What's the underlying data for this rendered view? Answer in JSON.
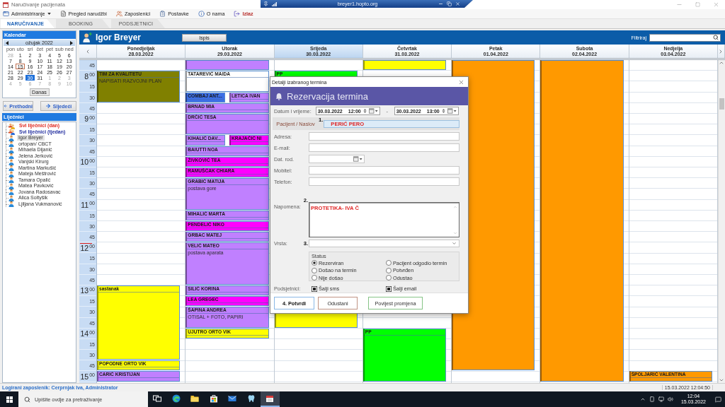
{
  "window": {
    "title": "Naručivanje pacijenata",
    "remote_host": "breyer1.hopto.org"
  },
  "menu": [
    {
      "label": "Administriranje",
      "kind": "dropdown"
    },
    {
      "label": "Pregled narudžbi",
      "kind": "item"
    },
    {
      "label": "Zaposlenici",
      "kind": "item"
    },
    {
      "label": "Postavke",
      "kind": "item"
    },
    {
      "label": "O nama",
      "kind": "item"
    },
    {
      "label": "Izlaz",
      "kind": "exit"
    }
  ],
  "tabs": [
    {
      "label": "NARUČIVANJE",
      "selected": true
    },
    {
      "label": "BOOKING",
      "selected": false
    },
    {
      "label": "PODSJETNICI",
      "selected": false
    }
  ],
  "calendar": {
    "title": "Kalendar",
    "month": "ožujak 2022",
    "weekdays": [
      "pon",
      "uto",
      "sri",
      "čet",
      "pet",
      "sub",
      "ned"
    ],
    "weeks": [
      [
        {
          "day": "28",
          "other_month": true,
          "today": false,
          "selected": false
        },
        {
          "day": "1",
          "other_month": false,
          "today": false,
          "selected": false
        },
        {
          "day": "2",
          "other_month": false,
          "today": false,
          "selected": false
        },
        {
          "day": "3",
          "other_month": false,
          "today": false,
          "selected": false
        },
        {
          "day": "4",
          "other_month": false,
          "today": false,
          "selected": false
        },
        {
          "day": "5",
          "other_month": false,
          "today": false,
          "selected": false
        },
        {
          "day": "6",
          "other_month": false,
          "today": false,
          "selected": false
        }
      ],
      [
        {
          "day": "7",
          "other_month": false,
          "today": false,
          "selected": false
        },
        {
          "day": "8",
          "other_month": false,
          "today": false,
          "selected": false
        },
        {
          "day": "9",
          "other_month": false,
          "today": false,
          "selected": false
        },
        {
          "day": "10",
          "other_month": false,
          "today": false,
          "selected": false
        },
        {
          "day": "11",
          "other_month": false,
          "today": false,
          "selected": false
        },
        {
          "day": "12",
          "other_month": false,
          "today": false,
          "selected": false
        },
        {
          "day": "13",
          "other_month": false,
          "today": false,
          "selected": false
        }
      ],
      [
        {
          "day": "14",
          "other_month": false,
          "today": false,
          "selected": false
        },
        {
          "day": "15",
          "other_month": false,
          "today": true,
          "selected": false
        },
        {
          "day": "16",
          "other_month": false,
          "today": false,
          "selected": false
        },
        {
          "day": "17",
          "other_month": false,
          "today": false,
          "selected": false
        },
        {
          "day": "18",
          "other_month": false,
          "today": false,
          "selected": false
        },
        {
          "day": "19",
          "other_month": false,
          "today": false,
          "selected": false
        },
        {
          "day": "20",
          "other_month": false,
          "today": false,
          "selected": false
        }
      ],
      [
        {
          "day": "21",
          "other_month": false,
          "today": false,
          "selected": false
        },
        {
          "day": "22",
          "other_month": false,
          "today": false,
          "selected": false
        },
        {
          "day": "23",
          "other_month": false,
          "today": false,
          "selected": false
        },
        {
          "day": "24",
          "other_month": false,
          "today": false,
          "selected": false
        },
        {
          "day": "25",
          "other_month": false,
          "today": false,
          "selected": false
        },
        {
          "day": "26",
          "other_month": false,
          "today": false,
          "selected": false
        },
        {
          "day": "27",
          "other_month": false,
          "today": false,
          "selected": false
        }
      ],
      [
        {
          "day": "28",
          "other_month": false,
          "today": false,
          "selected": false
        },
        {
          "day": "29",
          "other_month": false,
          "today": false,
          "selected": false
        },
        {
          "day": "30",
          "other_month": false,
          "today": false,
          "selected": true
        },
        {
          "day": "31",
          "other_month": false,
          "today": false,
          "selected": false
        },
        {
          "day": "1",
          "other_month": true,
          "today": false,
          "selected": false
        },
        {
          "day": "2",
          "other_month": true,
          "today": false,
          "selected": false
        },
        {
          "day": "3",
          "other_month": true,
          "today": false,
          "selected": false
        }
      ],
      [
        {
          "day": "4",
          "other_month": true,
          "today": false,
          "selected": false
        },
        {
          "day": "5",
          "other_month": true,
          "today": false,
          "selected": false
        },
        {
          "day": "6",
          "other_month": true,
          "today": false,
          "selected": false
        },
        {
          "day": "7",
          "other_month": true,
          "today": false,
          "selected": false
        },
        {
          "day": "8",
          "other_month": true,
          "today": false,
          "selected": false
        },
        {
          "day": "9",
          "other_month": true,
          "today": false,
          "selected": false
        },
        {
          "day": "10",
          "other_month": true,
          "today": false,
          "selected": false
        }
      ]
    ],
    "today_button": "Danas"
  },
  "navigation": {
    "previous": "Prethodni",
    "next": "Sljedeći"
  },
  "doctors": {
    "title": "Liječnici",
    "items": [
      {
        "label": "Svi liječnici (dan)",
        "kind": "all_day",
        "selected": false
      },
      {
        "label": "Svi liječnici (tjedan)",
        "kind": "all_week",
        "selected": false
      },
      {
        "label": "Igor Breyer",
        "kind": "doctor",
        "selected": true
      },
      {
        "label": "ortopan/ CBCT",
        "kind": "doctor",
        "selected": false
      },
      {
        "label": "Mihaela Dijanić",
        "kind": "doctor",
        "selected": false
      },
      {
        "label": "Jelena Jerković",
        "kind": "doctor",
        "selected": false
      },
      {
        "label": "Vanjski Kirurg",
        "kind": "doctor",
        "selected": false
      },
      {
        "label": "Martina Markušić",
        "kind": "doctor",
        "selected": false
      },
      {
        "label": "Mateja Meštrović",
        "kind": "doctor",
        "selected": false
      },
      {
        "label": "Tamara Opalić",
        "kind": "doctor",
        "selected": false
      },
      {
        "label": "Matea Pavković",
        "kind": "doctor",
        "selected": false
      },
      {
        "label": "Jovana Radosavac",
        "kind": "doctor",
        "selected": false
      },
      {
        "label": "Alica Soltyšik",
        "kind": "doctor",
        "selected": false
      },
      {
        "label": "Ljiljana Vukmanović",
        "kind": "doctor",
        "selected": false
      }
    ]
  },
  "schedule": {
    "doctor": "Igor Breyer",
    "print_button": "Ispis",
    "filter_label": "Filtriraj",
    "time_slots": [
      {
        "minute": "45",
        "now": false
      },
      {
        "hour": "8",
        "minute": "00",
        "now": false
      },
      {
        "minute": "15",
        "now": false
      },
      {
        "minute": "30",
        "now": false
      },
      {
        "minute": "45",
        "now": false
      },
      {
        "hour": "9",
        "minute": "00",
        "now": false
      },
      {
        "minute": "15",
        "now": false
      },
      {
        "minute": "30",
        "now": false
      },
      {
        "minute": "45",
        "now": false
      },
      {
        "hour": "10",
        "minute": "00",
        "now": false
      },
      {
        "minute": "15",
        "now": false
      },
      {
        "minute": "30",
        "now": false
      },
      {
        "minute": "45",
        "now": false
      },
      {
        "hour": "11",
        "minute": "00",
        "now": false
      },
      {
        "minute": "15",
        "now": false
      },
      {
        "minute": "30",
        "now": false
      },
      {
        "minute": "45",
        "now": false
      },
      {
        "hour": "12",
        "minute": "00",
        "now": true
      },
      {
        "minute": "15",
        "now": false
      },
      {
        "minute": "30",
        "now": false
      },
      {
        "minute": "45",
        "now": false
      },
      {
        "hour": "13",
        "minute": "00",
        "now": false
      },
      {
        "minute": "15",
        "now": false
      },
      {
        "minute": "30",
        "now": false
      },
      {
        "minute": "45",
        "now": false
      },
      {
        "hour": "14",
        "minute": "00",
        "now": false
      },
      {
        "minute": "15",
        "now": false
      },
      {
        "minute": "30",
        "now": false
      },
      {
        "minute": "45",
        "now": false
      },
      {
        "hour": "15",
        "minute": "00",
        "now": false
      }
    ],
    "days": [
      {
        "name": "Ponedjeljak",
        "date": "28.03.2022",
        "selected": false,
        "rows": [
          {
            "kind": "empty"
          },
          {
            "kind": "appointment",
            "title": "TIM ZA KVALITETU",
            "note": "NAPISATI RAZVOJNI PLAN",
            "color": "#808000"
          },
          {
            "kind": "continued"
          },
          {
            "kind": "continued"
          },
          {
            "kind": "empty"
          },
          {
            "kind": "empty"
          },
          {
            "kind": "empty"
          },
          {
            "kind": "empty"
          },
          {
            "kind": "empty"
          },
          {
            "kind": "empty"
          },
          {
            "kind": "empty"
          },
          {
            "kind": "empty"
          },
          {
            "kind": "empty"
          },
          {
            "kind": "empty"
          },
          {
            "kind": "empty"
          },
          {
            "kind": "empty"
          },
          {
            "kind": "empty"
          },
          {
            "kind": "empty"
          },
          {
            "kind": "empty"
          },
          {
            "kind": "empty"
          },
          {
            "kind": "empty"
          },
          {
            "kind": "appointment",
            "title": "sastanak",
            "color": "#ffff00"
          },
          {
            "kind": "continued"
          },
          {
            "kind": "continued"
          },
          {
            "kind": "continued"
          },
          {
            "kind": "continued"
          },
          {
            "kind": "continued"
          },
          {
            "kind": "continued"
          },
          {
            "kind": "appointment",
            "title": "POPODNE ORTO VIK",
            "color": "#ffff00"
          },
          {
            "kind": "appointment",
            "title": "CARIĆ KRISTIJAN",
            "color": "#c080ff"
          }
        ]
      },
      {
        "name": "Utorak",
        "date": "29.03.2022",
        "selected": false,
        "rows": [
          {
            "kind": "appointment",
            "color": "#c080ff"
          },
          {
            "kind": "appointment",
            "title": "TATAREVIĆ MAIDA",
            "color": "#ffffff"
          },
          {
            "kind": "continued"
          },
          {
            "kind": "split",
            "appointments": [
              {
                "title": "COMBAJ ANT...",
                "color": "#3d6ee6"
              },
              {
                "title": "LETICA IVAN",
                "color": "#c080ff"
              }
            ]
          },
          {
            "kind": "appointment",
            "title": "BRNAD MIA",
            "color": "#c080ff"
          },
          {
            "kind": "appointment",
            "title": "DRČIĆ TESA",
            "color": "#c080ff"
          },
          {
            "kind": "continued"
          },
          {
            "kind": "split",
            "appointments": [
              {
                "title": "KIHALIĆ DAV...",
                "color": "#c080ff"
              },
              {
                "title": "KRAJAČIĆ NI",
                "color": "#ff00ff"
              }
            ]
          },
          {
            "kind": "appointment",
            "title": "BAIUTTI NOA",
            "color": "#c080ff"
          },
          {
            "kind": "appointment",
            "title": "ŽIVKOVIĆ TEA",
            "color": "#ff00ff"
          },
          {
            "kind": "appointment",
            "title": "RAMUŠĆAK CHIARA",
            "color": "#ff00ff"
          },
          {
            "kind": "appointment",
            "title": "GRABIĆ MATIJA",
            "note": "postava gore",
            "color": "#c080ff"
          },
          {
            "kind": "continued"
          },
          {
            "kind": "continued"
          },
          {
            "kind": "appointment",
            "title": "MIHALIĆ MARTA",
            "color": "#c080ff"
          },
          {
            "kind": "appointment",
            "title": "PENDELIĆ NIKO",
            "color": "#ff00ff"
          },
          {
            "kind": "appointment",
            "title": "GRBAC MATEJ",
            "color": "#c080ff"
          },
          {
            "kind": "appointment",
            "title": "VELIĆ MATEO",
            "note": "postava aparata",
            "color": "#c080ff"
          },
          {
            "kind": "continued"
          },
          {
            "kind": "continued"
          },
          {
            "kind": "continued"
          },
          {
            "kind": "appointment",
            "title": "SILIĆ KORINA",
            "color": "#c080ff"
          },
          {
            "kind": "appointment",
            "title": "LEA GREGEC",
            "color": "#ff00ff"
          },
          {
            "kind": "appointment",
            "title": "ŠAPINA ANDREA",
            "note": "OTISAL + FOTO, PAPIRI",
            "color": "#c080ff"
          },
          {
            "kind": "continued"
          },
          {
            "kind": "appointment",
            "title": "UJUTRO ORTO VIK",
            "color": "#ffff00"
          }
        ]
      },
      {
        "name": "Srijeda",
        "date": "30.03.2022",
        "selected": true,
        "rows": [
          {
            "kind": "empty"
          },
          {
            "kind": "appointment",
            "title": "PP",
            "color": "#00ff00"
          },
          {
            "kind": "empty"
          },
          {
            "kind": "empty"
          },
          {
            "kind": "empty"
          },
          {
            "kind": "empty"
          },
          {
            "kind": "empty"
          },
          {
            "kind": "empty"
          },
          {
            "kind": "empty"
          },
          {
            "kind": "empty"
          },
          {
            "kind": "empty"
          },
          {
            "kind": "empty"
          },
          {
            "kind": "empty"
          },
          {
            "kind": "empty"
          },
          {
            "kind": "empty"
          },
          {
            "kind": "empty"
          },
          {
            "kind": "empty"
          },
          {
            "kind": "empty"
          },
          {
            "kind": "empty"
          },
          {
            "kind": "empty"
          },
          {
            "kind": "empty"
          },
          {
            "kind": "empty"
          },
          {
            "kind": "empty"
          },
          {
            "kind": "appointment",
            "color": "#ffff00"
          },
          {
            "kind": "continued"
          }
        ]
      },
      {
        "name": "Četvrtak",
        "date": "31.03.2022",
        "selected": false,
        "rows": [
          {
            "kind": "appointment",
            "color": "#ffff00"
          },
          {
            "kind": "empty"
          },
          {
            "kind": "empty"
          },
          {
            "kind": "empty"
          },
          {
            "kind": "empty"
          },
          {
            "kind": "empty"
          },
          {
            "kind": "empty"
          },
          {
            "kind": "empty"
          },
          {
            "kind": "empty"
          },
          {
            "kind": "empty"
          },
          {
            "kind": "empty"
          },
          {
            "kind": "empty"
          },
          {
            "kind": "empty"
          },
          {
            "kind": "empty"
          },
          {
            "kind": "empty"
          },
          {
            "kind": "empty"
          },
          {
            "kind": "empty"
          },
          {
            "kind": "empty"
          },
          {
            "kind": "empty"
          },
          {
            "kind": "empty"
          },
          {
            "kind": "empty"
          },
          {
            "kind": "empty"
          },
          {
            "kind": "empty"
          },
          {
            "kind": "empty"
          },
          {
            "kind": "empty"
          },
          {
            "kind": "appointment",
            "title": "PP",
            "color": "#00ff00"
          },
          {
            "kind": "continued"
          },
          {
            "kind": "continued"
          },
          {
            "kind": "continued"
          },
          {
            "kind": "continued"
          }
        ]
      },
      {
        "name": "Petak",
        "date": "01.04.2022",
        "selected": false,
        "rows": [
          {
            "kind": "appointment",
            "color": "#ff9900"
          },
          {
            "kind": "continued"
          },
          {
            "kind": "continued"
          },
          {
            "kind": "continued"
          },
          {
            "kind": "continued"
          },
          {
            "kind": "continued"
          },
          {
            "kind": "continued"
          },
          {
            "kind": "continued"
          },
          {
            "kind": "continued"
          },
          {
            "kind": "continued"
          },
          {
            "kind": "continued"
          },
          {
            "kind": "continued"
          },
          {
            "kind": "continued"
          },
          {
            "kind": "continued"
          },
          {
            "kind": "continued"
          },
          {
            "kind": "continued"
          },
          {
            "kind": "continued"
          },
          {
            "kind": "continued"
          },
          {
            "kind": "continued"
          },
          {
            "kind": "continued"
          },
          {
            "kind": "continued"
          },
          {
            "kind": "continued"
          },
          {
            "kind": "continued"
          },
          {
            "kind": "continued"
          },
          {
            "kind": "continued"
          },
          {
            "kind": "continued"
          },
          {
            "kind": "continued"
          },
          {
            "kind": "continued"
          },
          {
            "kind": "continued"
          }
        ]
      },
      {
        "name": "Subota",
        "date": "02.04.2022",
        "selected": false,
        "rows": [
          {
            "kind": "appointment",
            "color": "#ff9900"
          },
          {
            "kind": "continued"
          },
          {
            "kind": "continued"
          },
          {
            "kind": "continued"
          },
          {
            "kind": "continued"
          },
          {
            "kind": "continued"
          },
          {
            "kind": "continued"
          },
          {
            "kind": "continued"
          },
          {
            "kind": "continued"
          },
          {
            "kind": "continued"
          },
          {
            "kind": "continued"
          },
          {
            "kind": "continued"
          },
          {
            "kind": "continued"
          },
          {
            "kind": "continued"
          },
          {
            "kind": "continued"
          },
          {
            "kind": "continued"
          },
          {
            "kind": "continued"
          },
          {
            "kind": "continued"
          },
          {
            "kind": "continued"
          },
          {
            "kind": "continued"
          },
          {
            "kind": "continued"
          },
          {
            "kind": "continued"
          },
          {
            "kind": "continued"
          },
          {
            "kind": "continued"
          },
          {
            "kind": "continued"
          },
          {
            "kind": "continued"
          },
          {
            "kind": "continued"
          },
          {
            "kind": "continued"
          },
          {
            "kind": "continued"
          },
          {
            "kind": "continued"
          }
        ]
      },
      {
        "name": "Nedjelja",
        "date": "03.04.2022",
        "selected": false,
        "rows": [
          {
            "kind": "empty"
          },
          {
            "kind": "empty"
          },
          {
            "kind": "empty"
          },
          {
            "kind": "empty"
          },
          {
            "kind": "empty"
          },
          {
            "kind": "empty"
          },
          {
            "kind": "empty"
          },
          {
            "kind": "empty"
          },
          {
            "kind": "empty"
          },
          {
            "kind": "empty"
          },
          {
            "kind": "empty"
          },
          {
            "kind": "empty"
          },
          {
            "kind": "empty"
          },
          {
            "kind": "empty"
          },
          {
            "kind": "empty"
          },
          {
            "kind": "empty"
          },
          {
            "kind": "empty"
          },
          {
            "kind": "empty"
          },
          {
            "kind": "empty"
          },
          {
            "kind": "empty"
          },
          {
            "kind": "empty"
          },
          {
            "kind": "empty"
          },
          {
            "kind": "empty"
          },
          {
            "kind": "empty"
          },
          {
            "kind": "empty"
          },
          {
            "kind": "empty"
          },
          {
            "kind": "empty"
          },
          {
            "kind": "empty"
          },
          {
            "kind": "empty"
          },
          {
            "kind": "appointment",
            "title": "ŠPOLJARIĆ VALENTINA",
            "color": "#ff9900"
          }
        ]
      }
    ]
  },
  "dialog": {
    "title": "Detalji izabranog termina",
    "heading": "Rezervacija termina",
    "datetime": {
      "label": "Datum i vrijeme:",
      "from": {
        "date": "30.03.2022",
        "time": "12:00"
      },
      "separator": "-",
      "to": {
        "date": "30.03.2022",
        "time": "13:00"
      }
    },
    "fields": [
      {
        "kind": "patient",
        "label": "Pacijent / Naslov",
        "marker": "1.",
        "value": "PERIĆ PERO"
      },
      {
        "kind": "text",
        "label": "Adresa:"
      },
      {
        "kind": "text",
        "label": "E-mail:"
      },
      {
        "kind": "date",
        "label": "Dat. rod."
      },
      {
        "kind": "text",
        "label": "Mobitel:"
      },
      {
        "kind": "text",
        "label": "Telefon:"
      },
      {
        "kind": "memo",
        "label": "Napomena:",
        "marker": "2.",
        "value": "PROTETIKA- IVA Č"
      },
      {
        "kind": "select",
        "label": "Vrsta:",
        "marker": "3."
      }
    ],
    "status": {
      "title": "Status",
      "options": [
        {
          "label": "Rezerviran",
          "selected": true
        },
        {
          "label": "Došao na termin",
          "selected": false
        },
        {
          "label": "Nije došao",
          "selected": false
        },
        {
          "label": "Pacijent odgodio termin",
          "selected": false
        },
        {
          "label": "Potvrđen",
          "selected": false
        },
        {
          "label": "Odustao",
          "selected": false
        }
      ]
    },
    "reminders": {
      "label": "Podsjetnici:",
      "options": [
        {
          "label": "Šalji sms",
          "checked": true
        },
        {
          "label": "Šalji email",
          "checked": true
        }
      ]
    },
    "buttons": [
      {
        "label": "4. Potvrdi",
        "kind": "confirm"
      },
      {
        "label": "Odustani",
        "kind": "cancel"
      },
      {
        "label": "Povijest promjena",
        "kind": "history"
      }
    ]
  },
  "status_bar": {
    "user": "Logirani zaposlenik: Cerprnjak Iva, Administrator",
    "timestamp": "15.03.2022 12:04:50"
  },
  "taskbar": {
    "search_placeholder": "Upišite ovdje za pretraživanje",
    "apps": [
      {
        "active": false
      },
      {
        "active": false
      },
      {
        "active": false
      },
      {
        "active": false
      },
      {
        "active": false
      },
      {
        "active": false
      },
      {
        "active": true
      }
    ],
    "time": "12:04",
    "date": "15.03.2022"
  }
}
